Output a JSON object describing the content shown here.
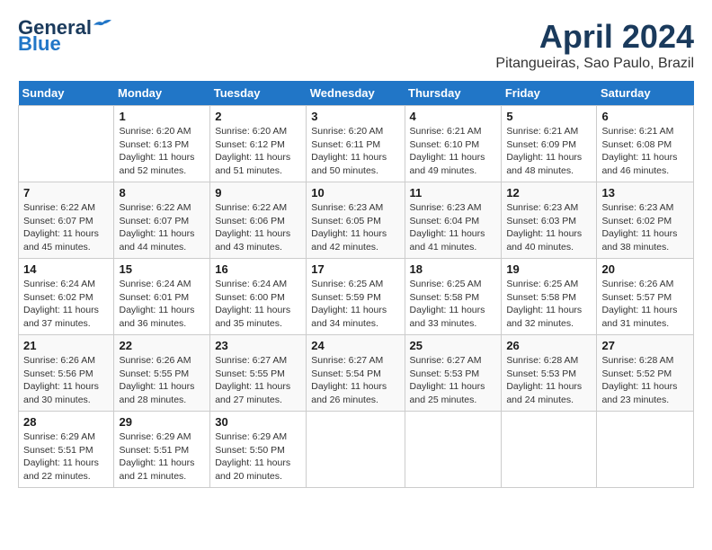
{
  "header": {
    "logo_line1": "General",
    "logo_line2": "Blue",
    "month": "April 2024",
    "location": "Pitangueiras, Sao Paulo, Brazil"
  },
  "columns": [
    "Sunday",
    "Monday",
    "Tuesday",
    "Wednesday",
    "Thursday",
    "Friday",
    "Saturday"
  ],
  "weeks": [
    [
      {
        "day": "",
        "info": ""
      },
      {
        "day": "1",
        "info": "Sunrise: 6:20 AM\nSunset: 6:13 PM\nDaylight: 11 hours\nand 52 minutes."
      },
      {
        "day": "2",
        "info": "Sunrise: 6:20 AM\nSunset: 6:12 PM\nDaylight: 11 hours\nand 51 minutes."
      },
      {
        "day": "3",
        "info": "Sunrise: 6:20 AM\nSunset: 6:11 PM\nDaylight: 11 hours\nand 50 minutes."
      },
      {
        "day": "4",
        "info": "Sunrise: 6:21 AM\nSunset: 6:10 PM\nDaylight: 11 hours\nand 49 minutes."
      },
      {
        "day": "5",
        "info": "Sunrise: 6:21 AM\nSunset: 6:09 PM\nDaylight: 11 hours\nand 48 minutes."
      },
      {
        "day": "6",
        "info": "Sunrise: 6:21 AM\nSunset: 6:08 PM\nDaylight: 11 hours\nand 46 minutes."
      }
    ],
    [
      {
        "day": "7",
        "info": "Sunrise: 6:22 AM\nSunset: 6:07 PM\nDaylight: 11 hours\nand 45 minutes."
      },
      {
        "day": "8",
        "info": "Sunrise: 6:22 AM\nSunset: 6:07 PM\nDaylight: 11 hours\nand 44 minutes."
      },
      {
        "day": "9",
        "info": "Sunrise: 6:22 AM\nSunset: 6:06 PM\nDaylight: 11 hours\nand 43 minutes."
      },
      {
        "day": "10",
        "info": "Sunrise: 6:23 AM\nSunset: 6:05 PM\nDaylight: 11 hours\nand 42 minutes."
      },
      {
        "day": "11",
        "info": "Sunrise: 6:23 AM\nSunset: 6:04 PM\nDaylight: 11 hours\nand 41 minutes."
      },
      {
        "day": "12",
        "info": "Sunrise: 6:23 AM\nSunset: 6:03 PM\nDaylight: 11 hours\nand 40 minutes."
      },
      {
        "day": "13",
        "info": "Sunrise: 6:23 AM\nSunset: 6:02 PM\nDaylight: 11 hours\nand 38 minutes."
      }
    ],
    [
      {
        "day": "14",
        "info": "Sunrise: 6:24 AM\nSunset: 6:02 PM\nDaylight: 11 hours\nand 37 minutes."
      },
      {
        "day": "15",
        "info": "Sunrise: 6:24 AM\nSunset: 6:01 PM\nDaylight: 11 hours\nand 36 minutes."
      },
      {
        "day": "16",
        "info": "Sunrise: 6:24 AM\nSunset: 6:00 PM\nDaylight: 11 hours\nand 35 minutes."
      },
      {
        "day": "17",
        "info": "Sunrise: 6:25 AM\nSunset: 5:59 PM\nDaylight: 11 hours\nand 34 minutes."
      },
      {
        "day": "18",
        "info": "Sunrise: 6:25 AM\nSunset: 5:58 PM\nDaylight: 11 hours\nand 33 minutes."
      },
      {
        "day": "19",
        "info": "Sunrise: 6:25 AM\nSunset: 5:58 PM\nDaylight: 11 hours\nand 32 minutes."
      },
      {
        "day": "20",
        "info": "Sunrise: 6:26 AM\nSunset: 5:57 PM\nDaylight: 11 hours\nand 31 minutes."
      }
    ],
    [
      {
        "day": "21",
        "info": "Sunrise: 6:26 AM\nSunset: 5:56 PM\nDaylight: 11 hours\nand 30 minutes."
      },
      {
        "day": "22",
        "info": "Sunrise: 6:26 AM\nSunset: 5:55 PM\nDaylight: 11 hours\nand 28 minutes."
      },
      {
        "day": "23",
        "info": "Sunrise: 6:27 AM\nSunset: 5:55 PM\nDaylight: 11 hours\nand 27 minutes."
      },
      {
        "day": "24",
        "info": "Sunrise: 6:27 AM\nSunset: 5:54 PM\nDaylight: 11 hours\nand 26 minutes."
      },
      {
        "day": "25",
        "info": "Sunrise: 6:27 AM\nSunset: 5:53 PM\nDaylight: 11 hours\nand 25 minutes."
      },
      {
        "day": "26",
        "info": "Sunrise: 6:28 AM\nSunset: 5:53 PM\nDaylight: 11 hours\nand 24 minutes."
      },
      {
        "day": "27",
        "info": "Sunrise: 6:28 AM\nSunset: 5:52 PM\nDaylight: 11 hours\nand 23 minutes."
      }
    ],
    [
      {
        "day": "28",
        "info": "Sunrise: 6:29 AM\nSunset: 5:51 PM\nDaylight: 11 hours\nand 22 minutes."
      },
      {
        "day": "29",
        "info": "Sunrise: 6:29 AM\nSunset: 5:51 PM\nDaylight: 11 hours\nand 21 minutes."
      },
      {
        "day": "30",
        "info": "Sunrise: 6:29 AM\nSunset: 5:50 PM\nDaylight: 11 hours\nand 20 minutes."
      },
      {
        "day": "",
        "info": ""
      },
      {
        "day": "",
        "info": ""
      },
      {
        "day": "",
        "info": ""
      },
      {
        "day": "",
        "info": ""
      }
    ]
  ]
}
